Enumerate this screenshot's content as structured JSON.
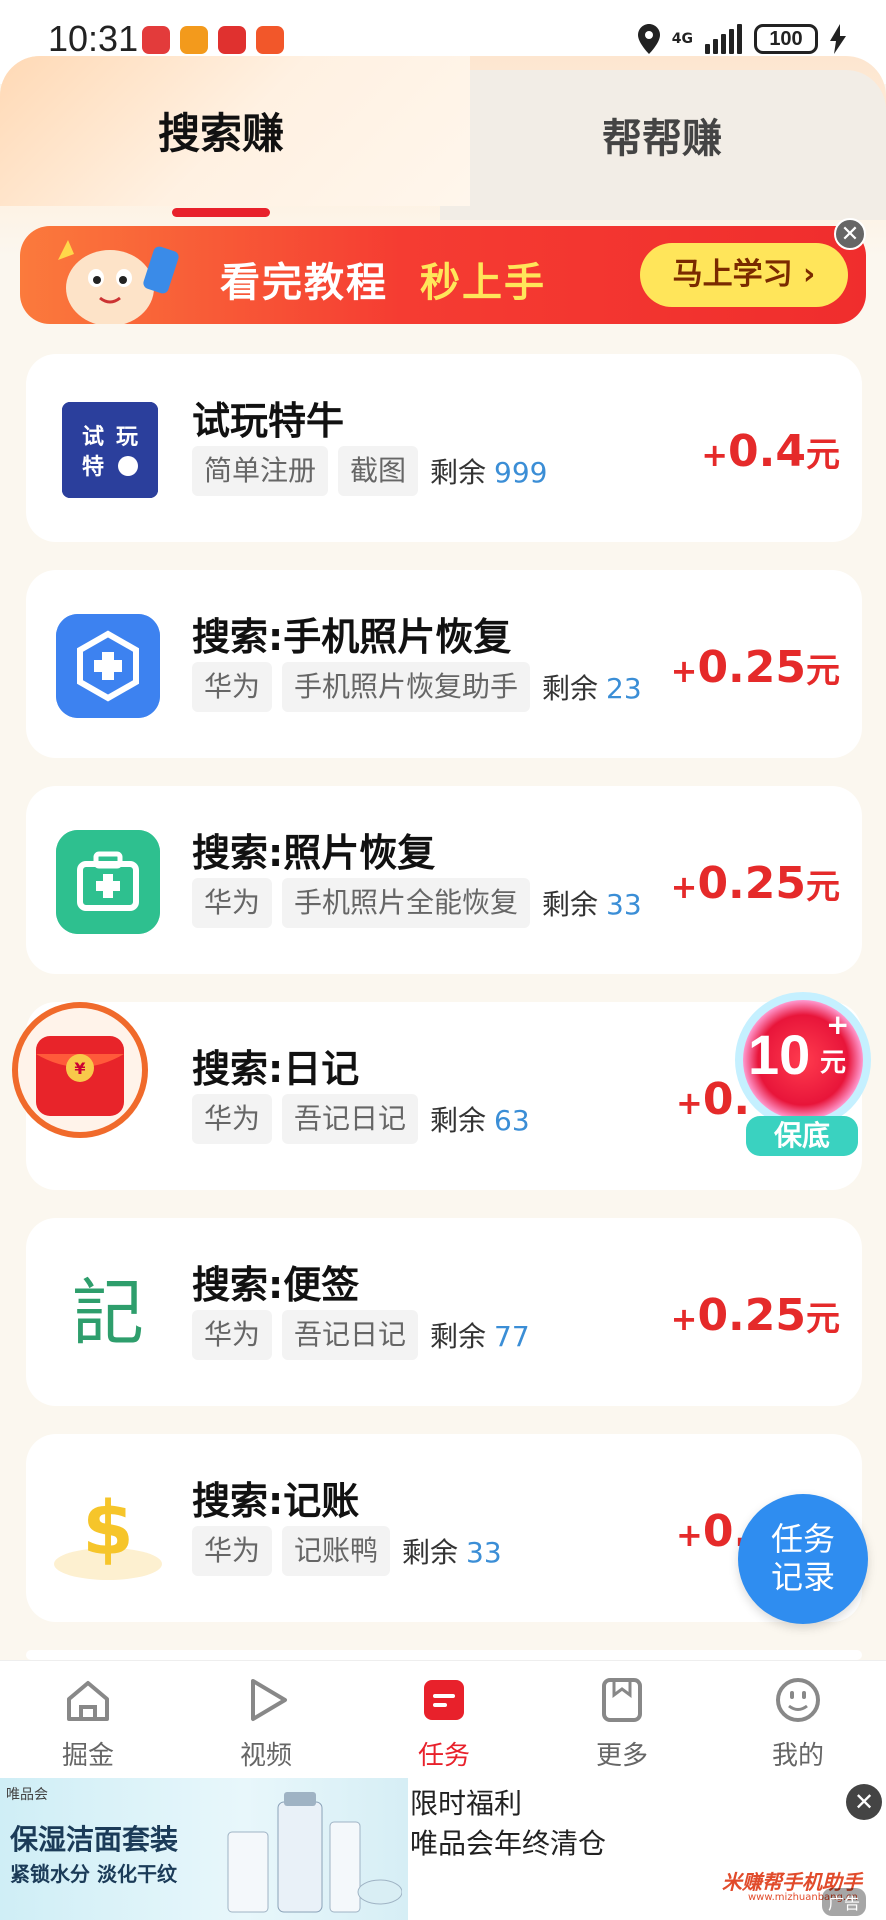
{
  "status_bar": {
    "time": "10:31",
    "network": "4G",
    "battery": "100"
  },
  "tabs": [
    {
      "label": "搜索赚",
      "active": true
    },
    {
      "label": "帮帮赚",
      "active": false
    }
  ],
  "banner": {
    "text1": "看完教程",
    "text2": "秒上手",
    "button_label": "马上学习 ›",
    "close": "✕"
  },
  "tasks": [
    {
      "title": "试玩特牛",
      "tags": [
        "简单注册",
        "截图"
      ],
      "remain_label": "剩余",
      "remain": "999",
      "reward": {
        "plus": "+",
        "amount": "0.4",
        "unit": "元"
      },
      "icon": "shiwan-teniu-app-icon",
      "icon_text": [
        "试",
        "玩",
        "特",
        "牛"
      ]
    },
    {
      "title": "搜索:手机照片恢复",
      "tags": [
        "华为",
        "手机照片恢复助手"
      ],
      "remain_label": "剩余",
      "remain": "23",
      "reward": {
        "plus": "+",
        "amount": "0.25",
        "unit": "元"
      },
      "icon": "medical-shield-app-icon"
    },
    {
      "title": "搜索:照片恢复",
      "tags": [
        "华为",
        "手机照片全能恢复"
      ],
      "remain_label": "剩余",
      "remain": "33",
      "reward": {
        "plus": "+",
        "amount": "0.25",
        "unit": "元"
      },
      "icon": "medical-kit-app-icon"
    },
    {
      "title": "搜索:日记",
      "tags": [
        "华为",
        "吾记日记"
      ],
      "remain_label": "剩余",
      "remain": "63",
      "reward": {
        "plus": "+",
        "amount": "0.",
        "unit": ""
      },
      "icon": "diary-app-icon"
    },
    {
      "title": "搜索:便签",
      "tags": [
        "华为",
        "吾记日记"
      ],
      "remain_label": "剩余",
      "remain": "77",
      "reward": {
        "plus": "+",
        "amount": "0.25",
        "unit": "元"
      },
      "icon": "ji-character-app-icon",
      "icon_text": "記"
    },
    {
      "title": "搜索:记账",
      "tags": [
        "华为",
        "记账鸭"
      ],
      "remain_label": "剩余",
      "remain": "33",
      "reward": {
        "plus": "+",
        "amount": "0.",
        "unit": ""
      },
      "icon": "dollar-duck-app-icon"
    }
  ],
  "bonus_float": {
    "amount": "10",
    "plus": "+",
    "unit": "元",
    "label": "保底"
  },
  "task_record_button": {
    "line1": "任务",
    "line2": "记录"
  },
  "bottom_nav": [
    {
      "label": "掘金",
      "icon": "home-icon",
      "active": false
    },
    {
      "label": "视频",
      "icon": "play-icon",
      "active": false
    },
    {
      "label": "任务",
      "icon": "task-icon",
      "active": true
    },
    {
      "label": "更多",
      "icon": "bookmark-icon",
      "active": false
    },
    {
      "label": "我的",
      "icon": "smile-icon",
      "active": false
    }
  ],
  "ad": {
    "brand": "唯品会",
    "image_title": "保湿洁面套装",
    "image_subtitle": "紧锁水分 淡化干纹",
    "line1": "限时福利",
    "line2": "唯品会年终清仓",
    "tag": "广告",
    "close": "✕",
    "watermark": "米赚帮手机助手",
    "watermark_url": "www.mizhuanbang.cn"
  },
  "colors": {
    "accent_red": "#e8212b",
    "reward_red": "#e52a2a",
    "remain_blue": "#3b8ed6",
    "float_blue": "#2f8df0"
  }
}
